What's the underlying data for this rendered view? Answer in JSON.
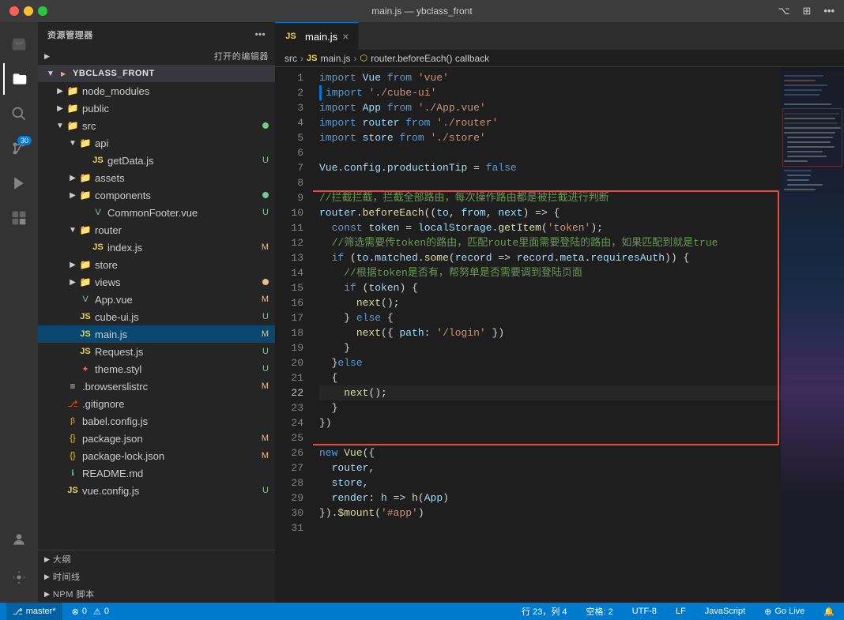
{
  "titlebar": {
    "title": "main.js — ybclass_front"
  },
  "breadcrumb": {
    "parts": [
      "src",
      "JS main.js",
      "router.beforeEach() callback"
    ]
  },
  "tabs": [
    {
      "label": "main.js",
      "active": true
    }
  ],
  "sidebar": {
    "title": "资源管理器",
    "open_editors_label": "打开的编辑器",
    "root": "YBCLASS_FRONT",
    "items": [
      {
        "type": "folder",
        "label": "node_modules",
        "indent": 1
      },
      {
        "type": "folder",
        "label": "public",
        "indent": 1
      },
      {
        "type": "folder",
        "label": "src",
        "indent": 1,
        "open": true,
        "dot": "green"
      },
      {
        "type": "folder",
        "label": "api",
        "indent": 2,
        "open": true
      },
      {
        "type": "file",
        "label": "getData.js",
        "indent": 3,
        "icon": "js",
        "badge": "U"
      },
      {
        "type": "folder",
        "label": "assets",
        "indent": 2
      },
      {
        "type": "folder",
        "label": "components",
        "indent": 2,
        "dot": "green"
      },
      {
        "type": "file",
        "label": "CommonFooter.vue",
        "indent": 3,
        "icon": "vue",
        "badge": "U"
      },
      {
        "type": "folder",
        "label": "router",
        "indent": 2,
        "open": true
      },
      {
        "type": "file",
        "label": "index.js",
        "indent": 3,
        "icon": "js",
        "badge": "M"
      },
      {
        "type": "folder",
        "label": "store",
        "indent": 2
      },
      {
        "type": "folder",
        "label": "views",
        "indent": 2,
        "dot": "yellow"
      },
      {
        "type": "file",
        "label": "App.vue",
        "indent": 2,
        "icon": "vue",
        "badge": "M"
      },
      {
        "type": "file",
        "label": "cube-ui.js",
        "indent": 2,
        "icon": "js",
        "badge": "U"
      },
      {
        "type": "file",
        "label": "main.js",
        "indent": 2,
        "icon": "js",
        "badge": "M",
        "selected": true
      },
      {
        "type": "file",
        "label": "Request.js",
        "indent": 2,
        "icon": "js",
        "badge": "U"
      },
      {
        "type": "file",
        "label": "theme.styl",
        "indent": 2,
        "icon": "styl",
        "badge": "U"
      },
      {
        "type": "file",
        "label": ".browserslistrc",
        "indent": 1,
        "icon": "browser",
        "badge": "M"
      },
      {
        "type": "file",
        "label": ".gitignore",
        "indent": 1,
        "icon": "git"
      },
      {
        "type": "file",
        "label": "babel.config.js",
        "indent": 1,
        "icon": "babel"
      },
      {
        "type": "file",
        "label": "package.json",
        "indent": 1,
        "icon": "json",
        "badge": "M"
      },
      {
        "type": "file",
        "label": "package-lock.json",
        "indent": 1,
        "icon": "json",
        "badge": "M"
      },
      {
        "type": "file",
        "label": "README.md",
        "indent": 1,
        "icon": "readme"
      },
      {
        "type": "file",
        "label": "vue.config.js",
        "indent": 1,
        "icon": "js",
        "badge": "U"
      }
    ]
  },
  "bottom_panels": [
    {
      "label": "大纲"
    },
    {
      "label": "时间线"
    },
    {
      "label": "NPM 脚本"
    }
  ],
  "code_lines": [
    {
      "num": 1,
      "content": "import Vue from 'vue'"
    },
    {
      "num": 2,
      "content": "import './cube-ui'"
    },
    {
      "num": 3,
      "content": "import App from './App.vue'"
    },
    {
      "num": 4,
      "content": "import router from './router'"
    },
    {
      "num": 5,
      "content": "import store from './store'"
    },
    {
      "num": 6,
      "content": ""
    },
    {
      "num": 7,
      "content": "Vue.config.productionTip = false"
    },
    {
      "num": 8,
      "content": ""
    },
    {
      "num": 9,
      "content": "//拦截拦截，拦截全部路由，每次操作路由都是被拦截进行判断"
    },
    {
      "num": 10,
      "content": "router.beforeEach((to, from, next) => {"
    },
    {
      "num": 11,
      "content": "  const token = localStorage.getItem('token');"
    },
    {
      "num": 12,
      "content": "  //筛选需要传token的路由，匹配route里面需要登陆的路由，如果匹配到就是true"
    },
    {
      "num": 13,
      "content": "  if (to.matched.some(record => record.meta.requiresAuth)) {"
    },
    {
      "num": 14,
      "content": "    //根据token是否有，帮努单是否需要调到登陆页面"
    },
    {
      "num": 15,
      "content": "    if (token) {"
    },
    {
      "num": 16,
      "content": "      next();"
    },
    {
      "num": 17,
      "content": "    } else {"
    },
    {
      "num": 18,
      "content": "      next({ path: '/login' })"
    },
    {
      "num": 19,
      "content": "    }"
    },
    {
      "num": 20,
      "content": "  }else"
    },
    {
      "num": 21,
      "content": "  {"
    },
    {
      "num": 22,
      "content": "    next();"
    },
    {
      "num": 23,
      "content": "  }"
    },
    {
      "num": 24,
      "content": "})"
    },
    {
      "num": 25,
      "content": ""
    },
    {
      "num": 26,
      "content": "new Vue({"
    },
    {
      "num": 27,
      "content": "  router,"
    },
    {
      "num": 28,
      "content": "  store,"
    },
    {
      "num": 29,
      "content": "  render: h => h(App)"
    },
    {
      "num": 30,
      "content": "}).$mount('#app')"
    },
    {
      "num": 31,
      "content": ""
    }
  ],
  "status_bar": {
    "branch": "master*",
    "errors": "0",
    "warnings": "0",
    "position": "行 23，列 4",
    "spaces": "空格: 2",
    "encoding": "UTF-8",
    "line_ending": "LF",
    "language": "JavaScript",
    "go_live": "Go Live"
  }
}
